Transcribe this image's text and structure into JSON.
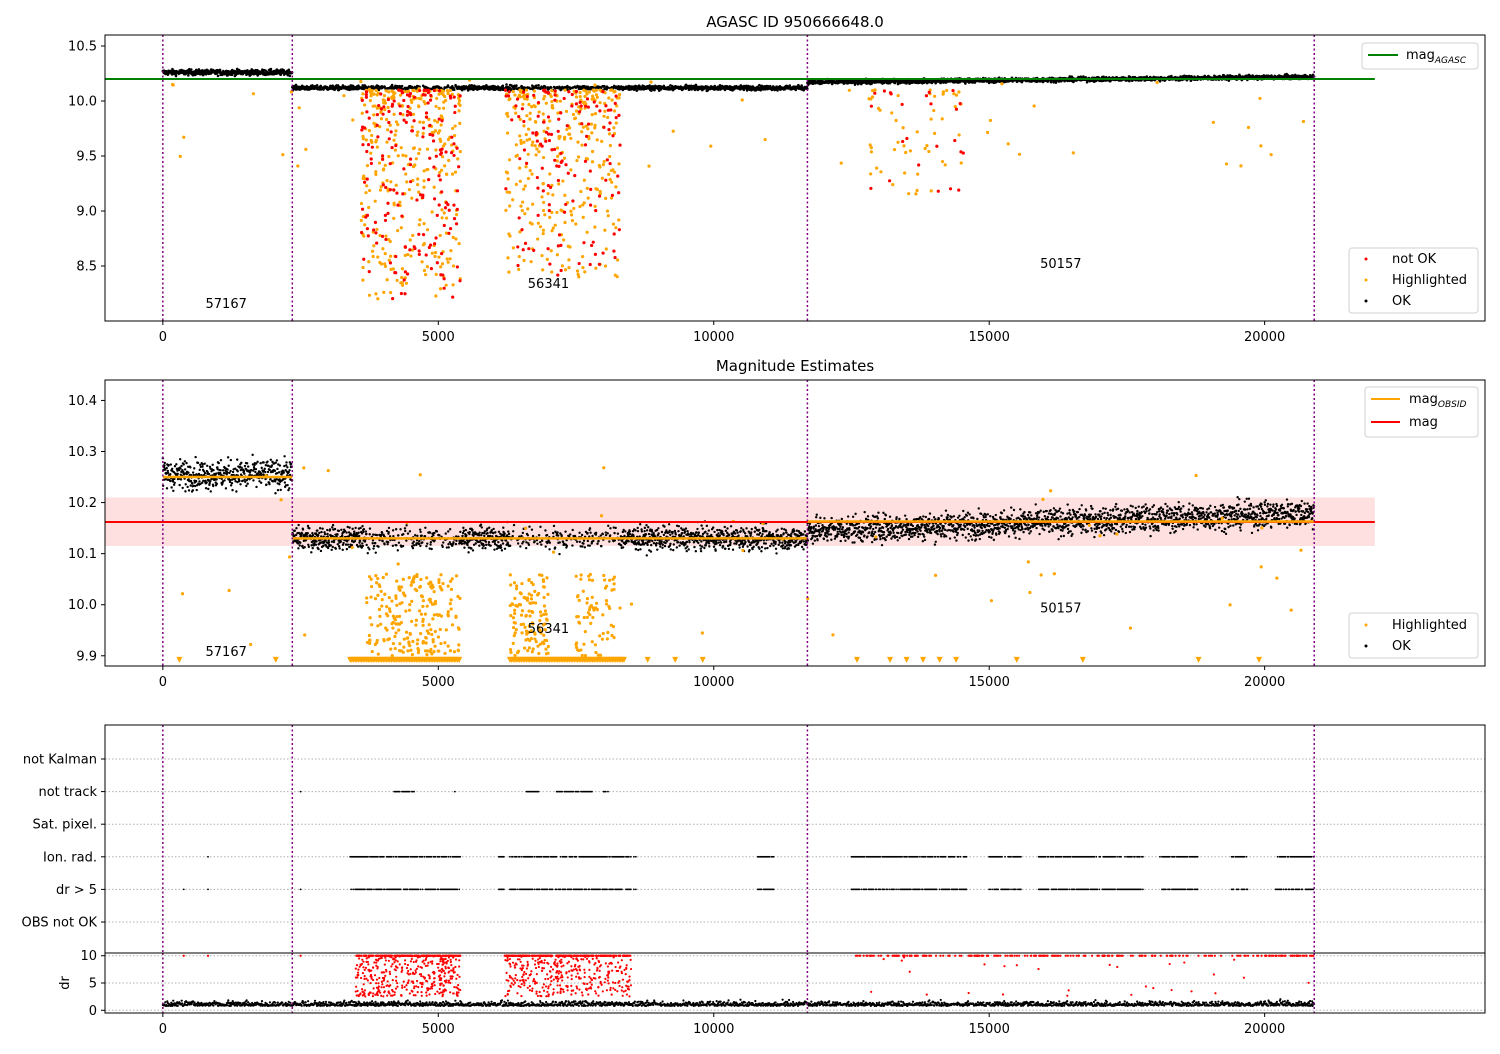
{
  "chart_data": [
    {
      "type": "scatter",
      "title": "AGASC ID 950666648.0",
      "xlim": [
        -1050,
        24000
      ],
      "ylim": [
        8.0,
        10.6
      ],
      "x_ticks": [
        0,
        5000,
        10000,
        15000,
        20000
      ],
      "y_ticks": [
        8.5,
        9.0,
        9.5,
        10.0,
        10.5
      ],
      "y_tick_labels": [
        "8.5",
        "9.0",
        "9.5",
        "10.0",
        "10.5"
      ],
      "obs_boundaries": [
        0,
        2350,
        11700,
        20900
      ],
      "obs_labels": [
        {
          "x": 1150,
          "y": 8.12,
          "text": "57167"
        },
        {
          "x": 7000,
          "y": 8.3,
          "text": "56341"
        },
        {
          "x": 16300,
          "y": 8.48,
          "text": "50157"
        }
      ],
      "reference_line": {
        "name": "mag",
        "sub": "AGASC",
        "value": 10.2,
        "color": "#008000",
        "x_range": [
          -1050,
          22000
        ]
      },
      "series": [
        {
          "name": "not OK",
          "color": "#ff0000"
        },
        {
          "name": "Highlighted",
          "color": "#ffa500"
        },
        {
          "name": "OK",
          "color": "#000000"
        }
      ]
    },
    {
      "type": "scatter",
      "title": "Magnitude Estimates",
      "xlim": [
        -1050,
        24000
      ],
      "ylim": [
        9.88,
        10.44
      ],
      "x_ticks": [
        0,
        5000,
        10000,
        15000,
        20000
      ],
      "y_ticks": [
        9.9,
        10.0,
        10.1,
        10.2,
        10.3,
        10.4
      ],
      "y_tick_labels": [
        "9.9",
        "10.0",
        "10.1",
        "10.2",
        "10.3",
        "10.4"
      ],
      "obs_boundaries": [
        0,
        2350,
        11700,
        20900
      ],
      "obs_labels": [
        {
          "x": 1150,
          "y": 9.9,
          "text": "57167"
        },
        {
          "x": 7000,
          "y": 9.945,
          "text": "56341"
        },
        {
          "x": 16300,
          "y": 9.985,
          "text": "50157"
        }
      ],
      "mean_mag": {
        "name": "mag",
        "value": 10.162,
        "band": [
          10.115,
          10.21
        ],
        "color": "#ff0000",
        "x_range": [
          -1050,
          22000
        ]
      },
      "obsid_mags": {
        "name": "mag",
        "sub": "OBSID",
        "color": "#ffa500",
        "segments": [
          {
            "x0": 0,
            "x1": 2350,
            "value": 10.25
          },
          {
            "x0": 2350,
            "x1": 11700,
            "value": 10.13
          },
          {
            "x0": 11700,
            "x1": 20900,
            "value": 10.163
          }
        ]
      },
      "series": [
        {
          "name": "Highlighted",
          "color": "#ffa500"
        },
        {
          "name": "OK",
          "color": "#000000"
        }
      ]
    },
    {
      "type": "scatter",
      "xlim": [
        -1050,
        24000
      ],
      "x_ticks": [
        0,
        5000,
        10000,
        15000,
        20000
      ],
      "flag_rows": [
        "not Kalman",
        "not track",
        "Sat. pixel.",
        "Ion. rad.",
        "dr > 5",
        "OBS not OK"
      ],
      "obs_boundaries": [
        0,
        2350,
        11700,
        20900
      ],
      "dr_ylabel": "dr",
      "dr_y_ticks": [
        0,
        5,
        10
      ],
      "dr_y_tick_labels": [
        "0",
        "5",
        "10"
      ],
      "dr_ylim": [
        -0.5,
        10.5
      ]
    }
  ]
}
